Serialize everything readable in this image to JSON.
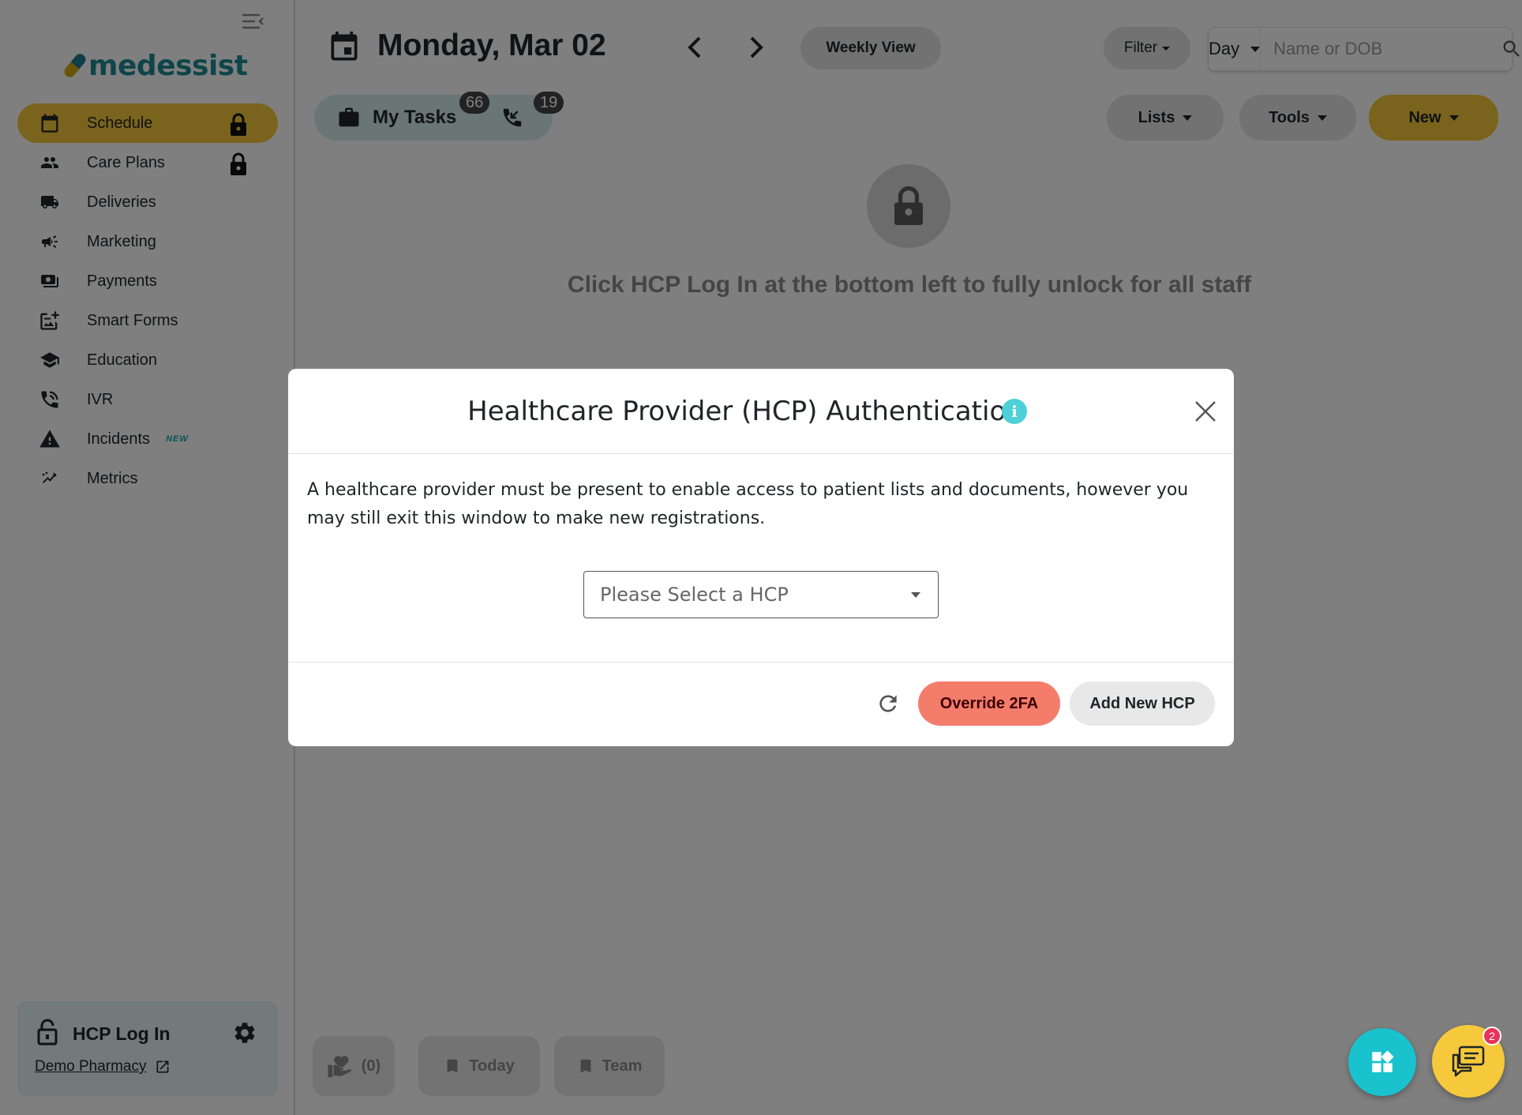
{
  "brand": {
    "logo_text": "medessist",
    "color": "#1e8b93",
    "accent": "#f5c93b"
  },
  "sidebar": {
    "items": [
      {
        "label": "Schedule",
        "icon": "calendar-icon",
        "active": true,
        "locked": true
      },
      {
        "label": "Care Plans",
        "icon": "people-icon",
        "locked": true
      },
      {
        "label": "Deliveries",
        "icon": "truck-icon"
      },
      {
        "label": "Marketing",
        "icon": "megaphone-icon"
      },
      {
        "label": "Payments",
        "icon": "payments-icon"
      },
      {
        "label": "Smart Forms",
        "icon": "form-icon"
      },
      {
        "label": "Education",
        "icon": "graduation-cap-icon"
      },
      {
        "label": "IVR",
        "icon": "phone-icon"
      },
      {
        "label": "Incidents",
        "icon": "warning-icon",
        "tag": "NEW"
      },
      {
        "label": "Metrics",
        "icon": "trend-icon"
      }
    ],
    "hcp_login": {
      "title": "HCP Log In",
      "pharmacy": "Demo Pharmacy"
    }
  },
  "header": {
    "date": "Monday, Mar 02",
    "weekly_view": "Weekly View",
    "filter": "Filter",
    "day_select": "Day",
    "search_placeholder": "Name or DOB",
    "my_tasks": "My Tasks",
    "tasks_count": "66",
    "calls_count": "19",
    "lists": "Lists",
    "tools": "Tools",
    "new": "New"
  },
  "main": {
    "unlock_message": "Click HCP Log In at the bottom left to fully unlock for all staff",
    "bottom": {
      "heart_count": "(0)",
      "today": "Today",
      "team": "Team"
    }
  },
  "chat_badge": "2",
  "modal": {
    "title": "Healthcare Provider (HCP) Authentication",
    "description": "A healthcare provider must be present to enable access to patient lists and documents, however you may still exit this window to make new registrations.",
    "select_placeholder": "Please Select a HCP",
    "override_button": "Override 2FA",
    "add_button": "Add New HCP"
  }
}
